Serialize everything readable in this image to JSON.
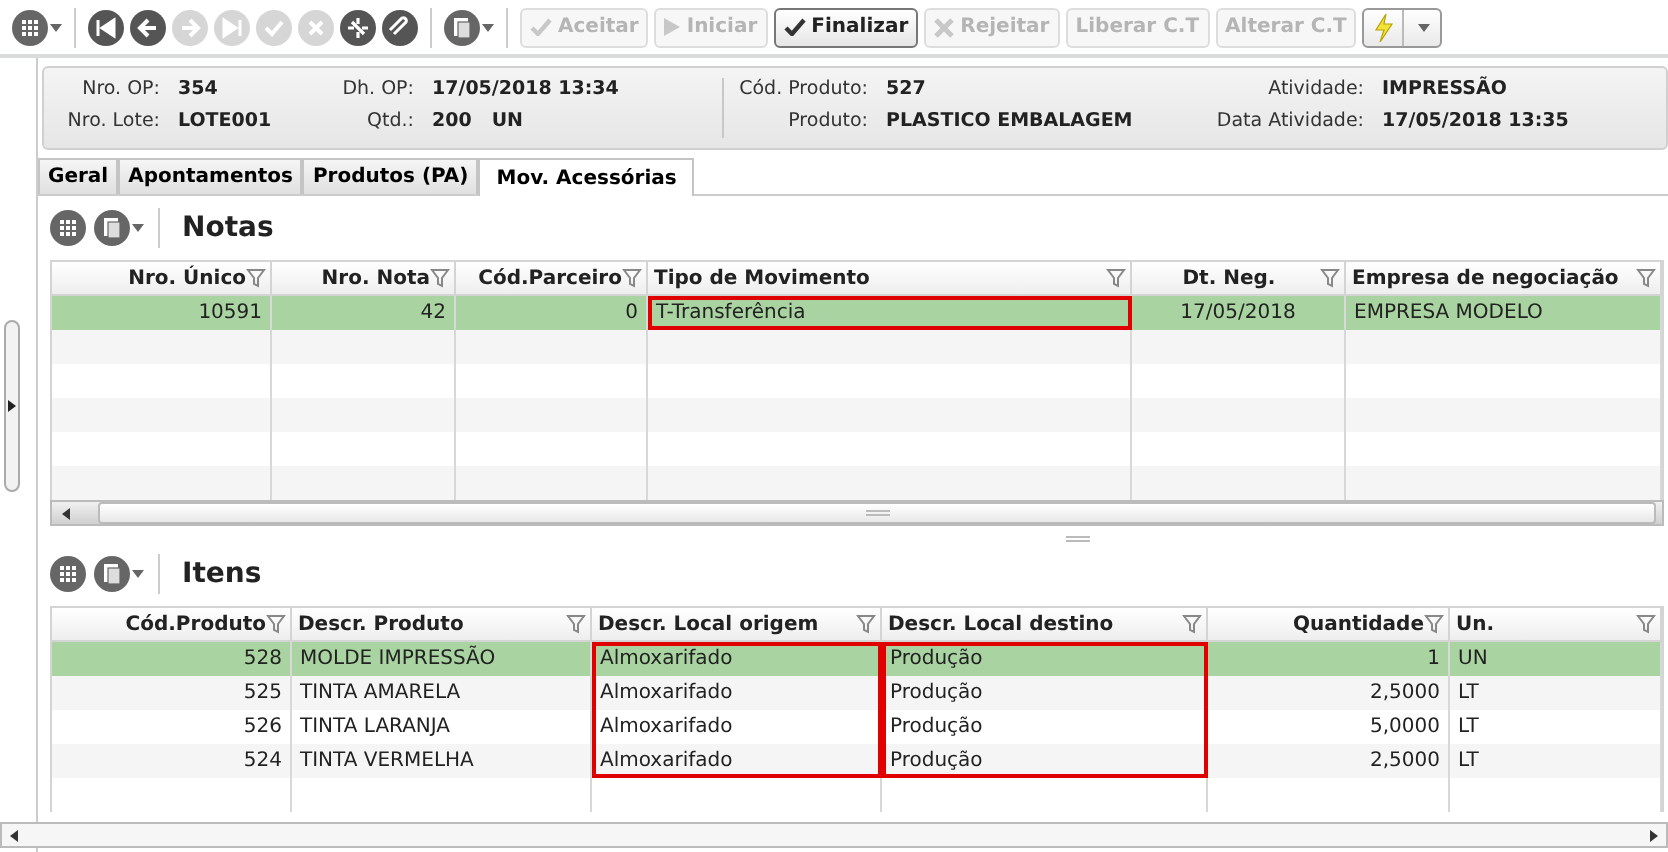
{
  "toolbar": {
    "nav_buttons": [
      {
        "kind": "first",
        "disabled": false
      },
      {
        "kind": "prev",
        "disabled": false
      },
      {
        "kind": "next",
        "disabled": true
      },
      {
        "kind": "last",
        "disabled": true
      },
      {
        "kind": "confirm",
        "disabled": true
      },
      {
        "kind": "cancel",
        "disabled": true
      },
      {
        "kind": "refresh",
        "disabled": false
      },
      {
        "kind": "attach",
        "disabled": false
      }
    ],
    "actions": [
      {
        "label": "Aceitar",
        "disabled": true
      },
      {
        "label": "Iniciar",
        "disabled": true
      },
      {
        "label": "Finalizar",
        "disabled": false
      },
      {
        "label": "Rejeitar",
        "disabled": true
      },
      {
        "label": "Liberar C.T",
        "disabled": true
      },
      {
        "label": "Alterar C.T",
        "disabled": true
      }
    ]
  },
  "header": [
    [
      {
        "label": "Nro. OP:",
        "value": "354"
      },
      {
        "label": "Nro. Lote:",
        "value": "LOTE001"
      }
    ],
    [
      {
        "label": "Dh. OP:",
        "value": "17/05/2018 13:34"
      },
      {
        "label": "Qtd.:",
        "value": "200",
        "unit": "UN"
      }
    ],
    [
      {
        "label": "Cód. Produto:",
        "value": "527"
      },
      {
        "label": "Produto:",
        "value": "PLASTICO EMBALAGEM"
      }
    ],
    [
      {
        "label": "Atividade:",
        "value": "IMPRESSÃO"
      },
      {
        "label": "Data Atividade:",
        "value": "17/05/2018 13:35"
      }
    ]
  ],
  "tabs": [
    {
      "label": "Geral",
      "selected": false
    },
    {
      "label": "Apontamentos",
      "selected": false
    },
    {
      "label": "Produtos (PA)",
      "selected": false
    },
    {
      "label": "Mov. Acessórias",
      "selected": true
    }
  ],
  "notas": {
    "title": "Notas",
    "columns": [
      {
        "label": "Nro. Único",
        "highlighted": false
      },
      {
        "label": "Nro. Nota",
        "highlighted": false
      },
      {
        "label": "Cód.Parceiro",
        "highlighted": false
      },
      {
        "label": "Tipo de Movimento",
        "highlighted": true
      },
      {
        "label": "Dt. Neg.",
        "highlighted": false
      },
      {
        "label": "Empresa de negociação",
        "highlighted": false
      }
    ],
    "rows": [
      {
        "selected": true,
        "cells": [
          "10591",
          "42",
          "0",
          "T-Transferência",
          "17/05/2018",
          "EMPRESA MODELO"
        ]
      }
    ]
  },
  "itens": {
    "title": "Itens",
    "columns": [
      {
        "label": "Cód.Produto",
        "highlighted": false
      },
      {
        "label": "Descr. Produto",
        "highlighted": false
      },
      {
        "label": "Descr. Local origem",
        "highlighted": true
      },
      {
        "label": "Descr. Local destino",
        "highlighted": true
      },
      {
        "label": "Quantidade",
        "highlighted": false
      },
      {
        "label": "Un.",
        "highlighted": false
      }
    ],
    "rows": [
      {
        "selected": true,
        "cells": [
          "528",
          "MOLDE IMPRESSÃO",
          "Almoxarifado",
          "Produção",
          "1",
          "UN"
        ]
      },
      {
        "selected": false,
        "cells": [
          "525",
          "TINTA AMARELA",
          "Almoxarifado",
          "Produção",
          "2,5000",
          "LT"
        ]
      },
      {
        "selected": false,
        "cells": [
          "526",
          "TINTA LARANJA",
          "Almoxarifado",
          "Produção",
          "5,0000",
          "LT"
        ]
      },
      {
        "selected": false,
        "cells": [
          "524",
          "TINTA VERMELHA",
          "Almoxarifado",
          "Produção",
          "2,5000",
          "LT"
        ]
      }
    ]
  }
}
